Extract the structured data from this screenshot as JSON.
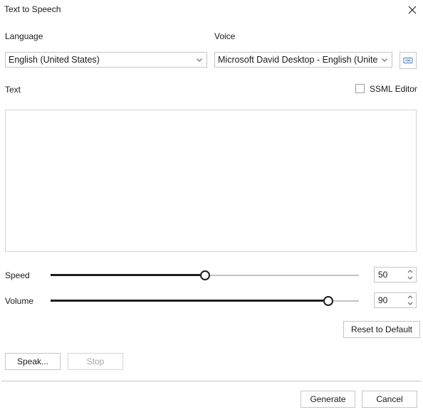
{
  "window": {
    "title": "Text to Speech",
    "close_icon": "close-icon"
  },
  "language": {
    "label": "Language",
    "selected": "English (United States)"
  },
  "voice": {
    "label": "Voice",
    "selected": "Microsoft David Desktop - English (United States)",
    "preview_icon": "audio-wave-icon"
  },
  "text": {
    "label": "Text",
    "value": "",
    "ssml_editor": {
      "label": "SSML Editor",
      "checked": false
    }
  },
  "speed": {
    "label": "Speed",
    "value": "50",
    "fraction": 0.5
  },
  "volume": {
    "label": "Volume",
    "value": "90",
    "fraction": 0.9
  },
  "buttons": {
    "reset": "Reset to Default",
    "speak": "Speak...",
    "stop": "Stop",
    "generate": "Generate",
    "cancel": "Cancel"
  }
}
